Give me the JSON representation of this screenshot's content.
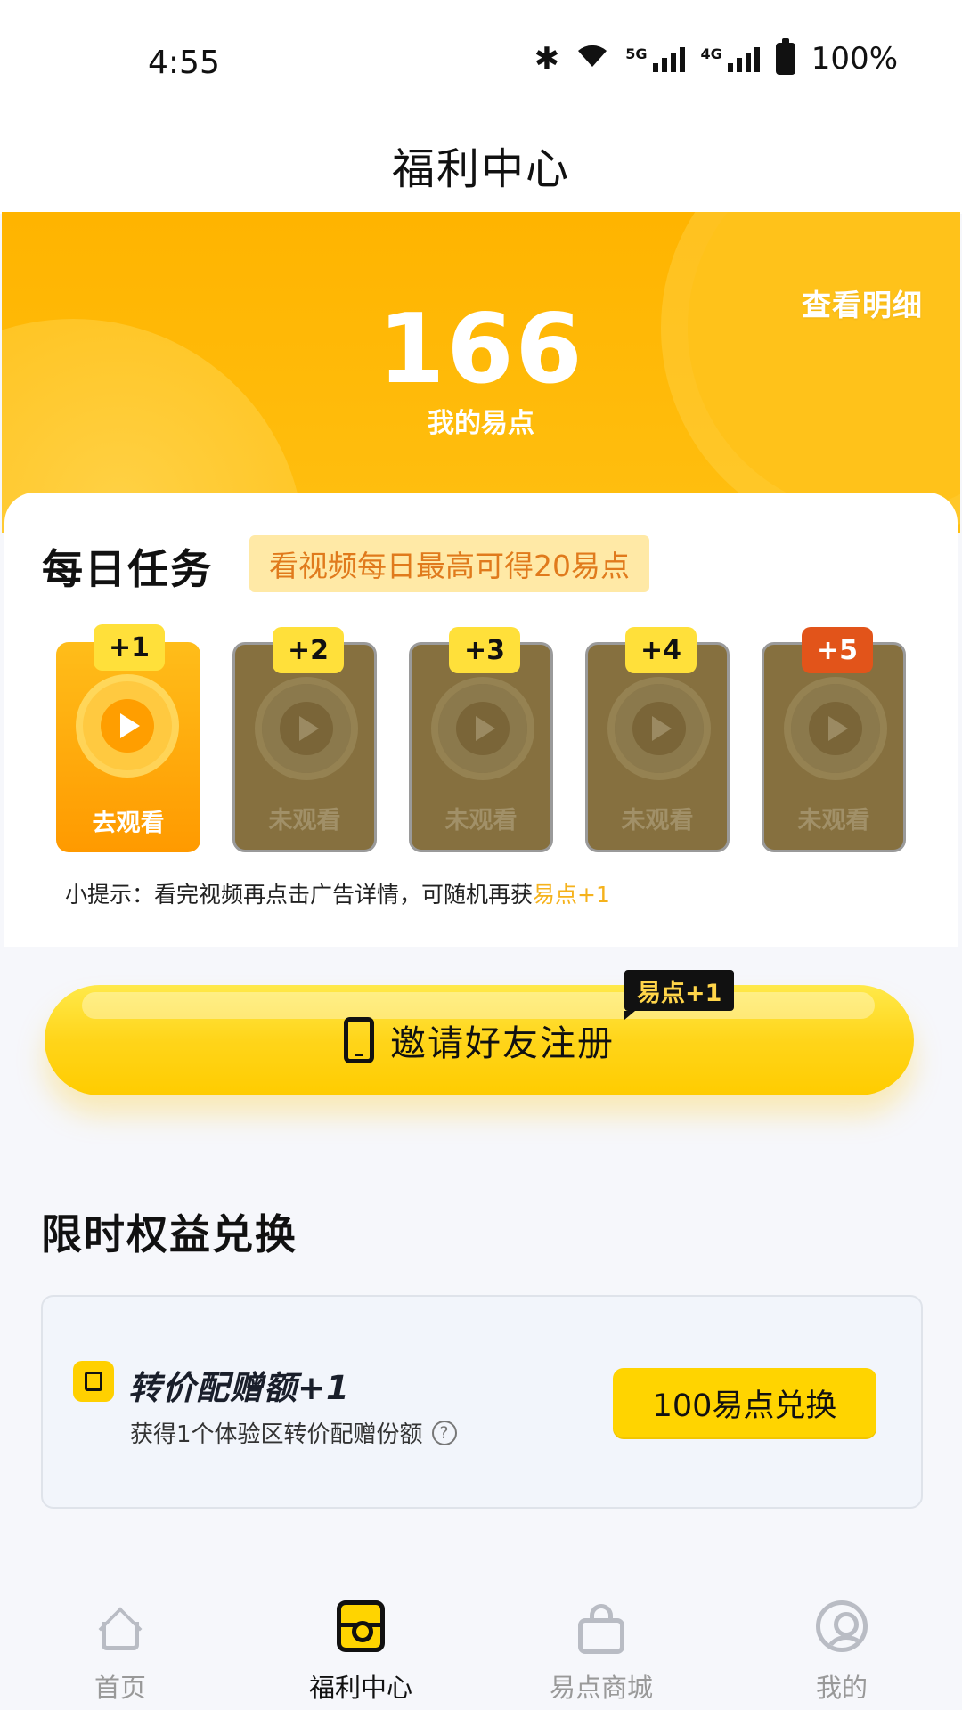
{
  "status_bar": {
    "time": "4:55",
    "network_1": "5G",
    "network_2": "4G",
    "battery": "100%"
  },
  "header": {
    "title": "福利中心"
  },
  "banner": {
    "points": "166",
    "points_label": "我的易点",
    "detail_link": "查看明细"
  },
  "daily_tasks": {
    "title": "每日任务",
    "tag": "看视频每日最高可得20易点",
    "videos": [
      {
        "badge": "+1",
        "label": "去观看",
        "state": "active"
      },
      {
        "badge": "+2",
        "label": "未观看",
        "state": "locked"
      },
      {
        "badge": "+3",
        "label": "未观看",
        "state": "locked"
      },
      {
        "badge": "+4",
        "label": "未观看",
        "state": "locked"
      },
      {
        "badge": "+5",
        "label": "未观看",
        "state": "locked"
      }
    ],
    "tip_prefix": "小提示：看完视频再点击广告详情，可随机再获",
    "tip_highlight": "易点+1"
  },
  "invite": {
    "label": "邀请好友注册",
    "badge": "易点+1",
    "icon": "phone-icon"
  },
  "exchange": {
    "title": "限时权益兑换",
    "item": {
      "name": "转价配赠额+1",
      "desc": "获得1个体验区转价配赠份额",
      "button": "100易点兑换"
    }
  },
  "bottom_nav": {
    "items": [
      {
        "label": "首页",
        "icon": "home-icon"
      },
      {
        "label": "福利中心",
        "icon": "welfare-icon",
        "active": true
      },
      {
        "label": "易点商城",
        "icon": "shop-bag-icon"
      },
      {
        "label": "我的",
        "icon": "profile-icon"
      }
    ]
  },
  "colors": {
    "accent": "#ffd400",
    "banner": "#ffb400",
    "tag_text": "#e07a1c",
    "red_badge": "#e2541a"
  }
}
